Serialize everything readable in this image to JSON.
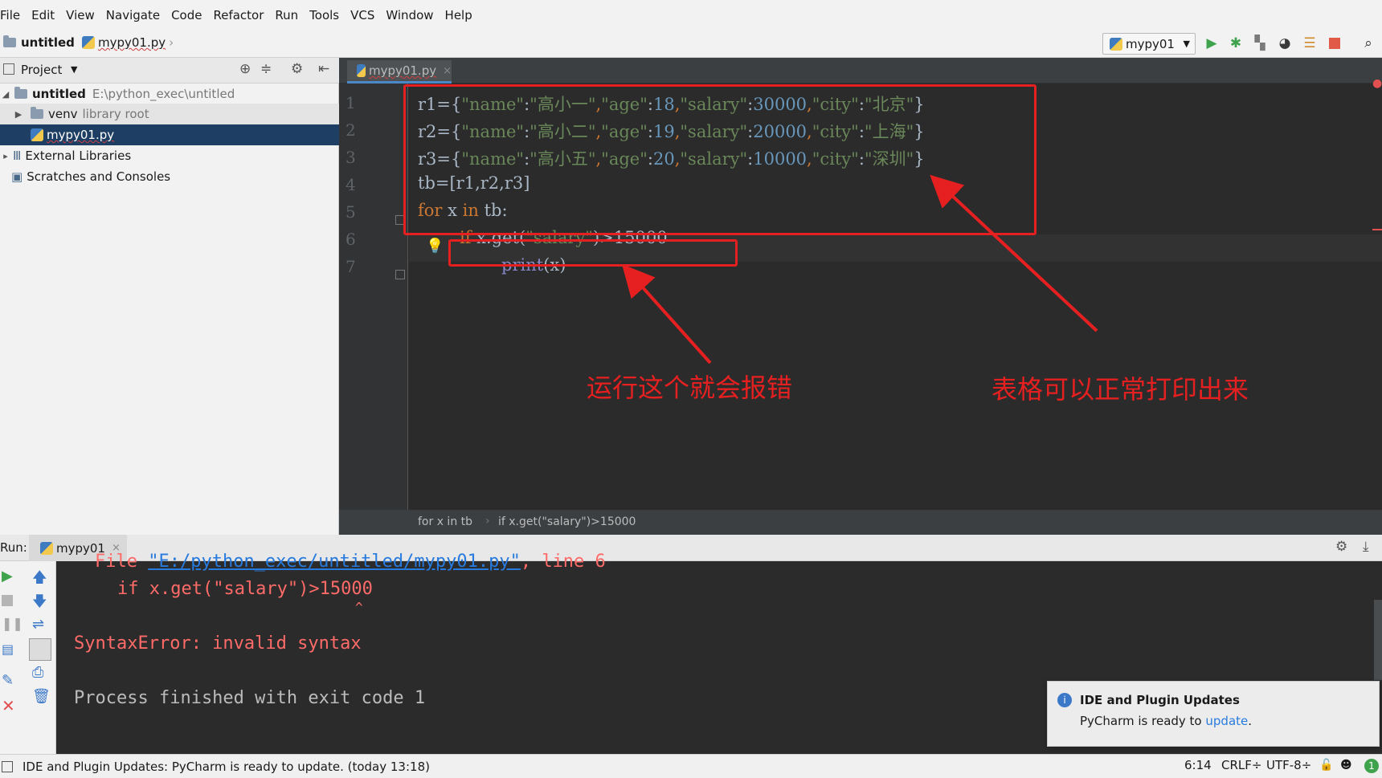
{
  "menu": [
    "File",
    "Edit",
    "View",
    "Navigate",
    "Code",
    "Refactor",
    "Run",
    "Tools",
    "VCS",
    "Window",
    "Help"
  ],
  "navbar": {
    "project": "untitled",
    "file": "mypy01.py",
    "run_config": "mypy01"
  },
  "project_panel": {
    "title": "Project",
    "root_name": "untitled",
    "root_path": "E:\\python_exec\\untitled",
    "venv": "venv",
    "venv_hint": "library root",
    "file": "mypy01.py",
    "external": "External Libraries",
    "scratches": "Scratches and Consoles"
  },
  "editor": {
    "tab": "mypy01.py",
    "line_numbers": [
      "1",
      "2",
      "3",
      "4",
      "5",
      "6",
      "7"
    ],
    "breadcrumb_1": "for x in tb",
    "breadcrumb_2": "if x.get(\"salary\")>15000"
  },
  "code": {
    "l1_a": "r1={",
    "l1_s1": "\"name\"",
    "l1_c1": ":",
    "l1_s2": "\"高小一\"",
    "l1_c2": ",",
    "l1_s3": "\"age\"",
    "l1_c3": ":",
    "l1_n1": "18",
    "l1_c4": ",",
    "l1_s4": "\"salary\"",
    "l1_c5": ":",
    "l1_n2": "30000",
    "l1_c6": ",",
    "l1_s5": "\"city\"",
    "l1_c7": ":",
    "l1_s6": "\"北京\"",
    "l1_end": "}",
    "l2_a": "r2={",
    "l2_s1": "\"name\"",
    "l2_c1": ":",
    "l2_s2": "\"高小二\"",
    "l2_c2": ",",
    "l2_s3": "\"age\"",
    "l2_c3": ":",
    "l2_n1": "19",
    "l2_c4": ",",
    "l2_s4": "\"salary\"",
    "l2_c5": ":",
    "l2_n2": "20000",
    "l2_c6": ",",
    "l2_s5": "\"city\"",
    "l2_c7": ":",
    "l2_s6": "\"上海\"",
    "l2_end": "}",
    "l3_a": "r3={",
    "l3_s1": "\"name\"",
    "l3_c1": ":",
    "l3_s2": "\"高小五\"",
    "l3_c2": ",",
    "l3_s3": "\"age\"",
    "l3_c3": ":",
    "l3_n1": "20",
    "l3_c4": ",",
    "l3_s4": "\"salary\"",
    "l3_c5": ":",
    "l3_n2": "10000",
    "l3_c6": ",",
    "l3_s5": "\"city\"",
    "l3_c7": ":",
    "l3_s6": "\"深圳\"",
    "l3_end": "}",
    "l4": "tb=[r1,r2,r3]",
    "l5_kw1": "for",
    "l5_mid": " x ",
    "l5_kw2": "in",
    "l5_end": " tb:",
    "l6_kw": "if",
    "l6_mid": " x.get(",
    "l6_s": "\"salary\"",
    "l6_end": ")>15000",
    "l7_fn": "print",
    "l7_end": "(x)"
  },
  "run_panel": {
    "label": "Run:",
    "tab": "mypy01",
    "line_file_a": "File ",
    "line_file_link": "\"E:/python_exec/untitled/mypy01.py\"",
    "line_file_b": ", line 6",
    "line_code": "if x.get(\"salary\")>15000",
    "line_caret": "^",
    "line_error": "SyntaxError: invalid syntax",
    "line_exit": "Process finished with exit code 1"
  },
  "notification": {
    "title": "IDE and Plugin Updates",
    "text": "PyCharm is ready to ",
    "link": "update",
    "period": "."
  },
  "status": {
    "message": "IDE and Plugin Updates: PyCharm is ready to update. (today 13:18)",
    "position": "6:14",
    "line_sep": "CRLF÷",
    "encoding": "UTF-8÷"
  },
  "annotations": {
    "left": "运行这个就会报错",
    "right": "表格可以正常打印出来"
  },
  "colors": {
    "annotation": "#e62020",
    "keyword": "#cc7832",
    "string": "#6a8759",
    "number": "#6897bb",
    "error": "#ff6b68"
  }
}
